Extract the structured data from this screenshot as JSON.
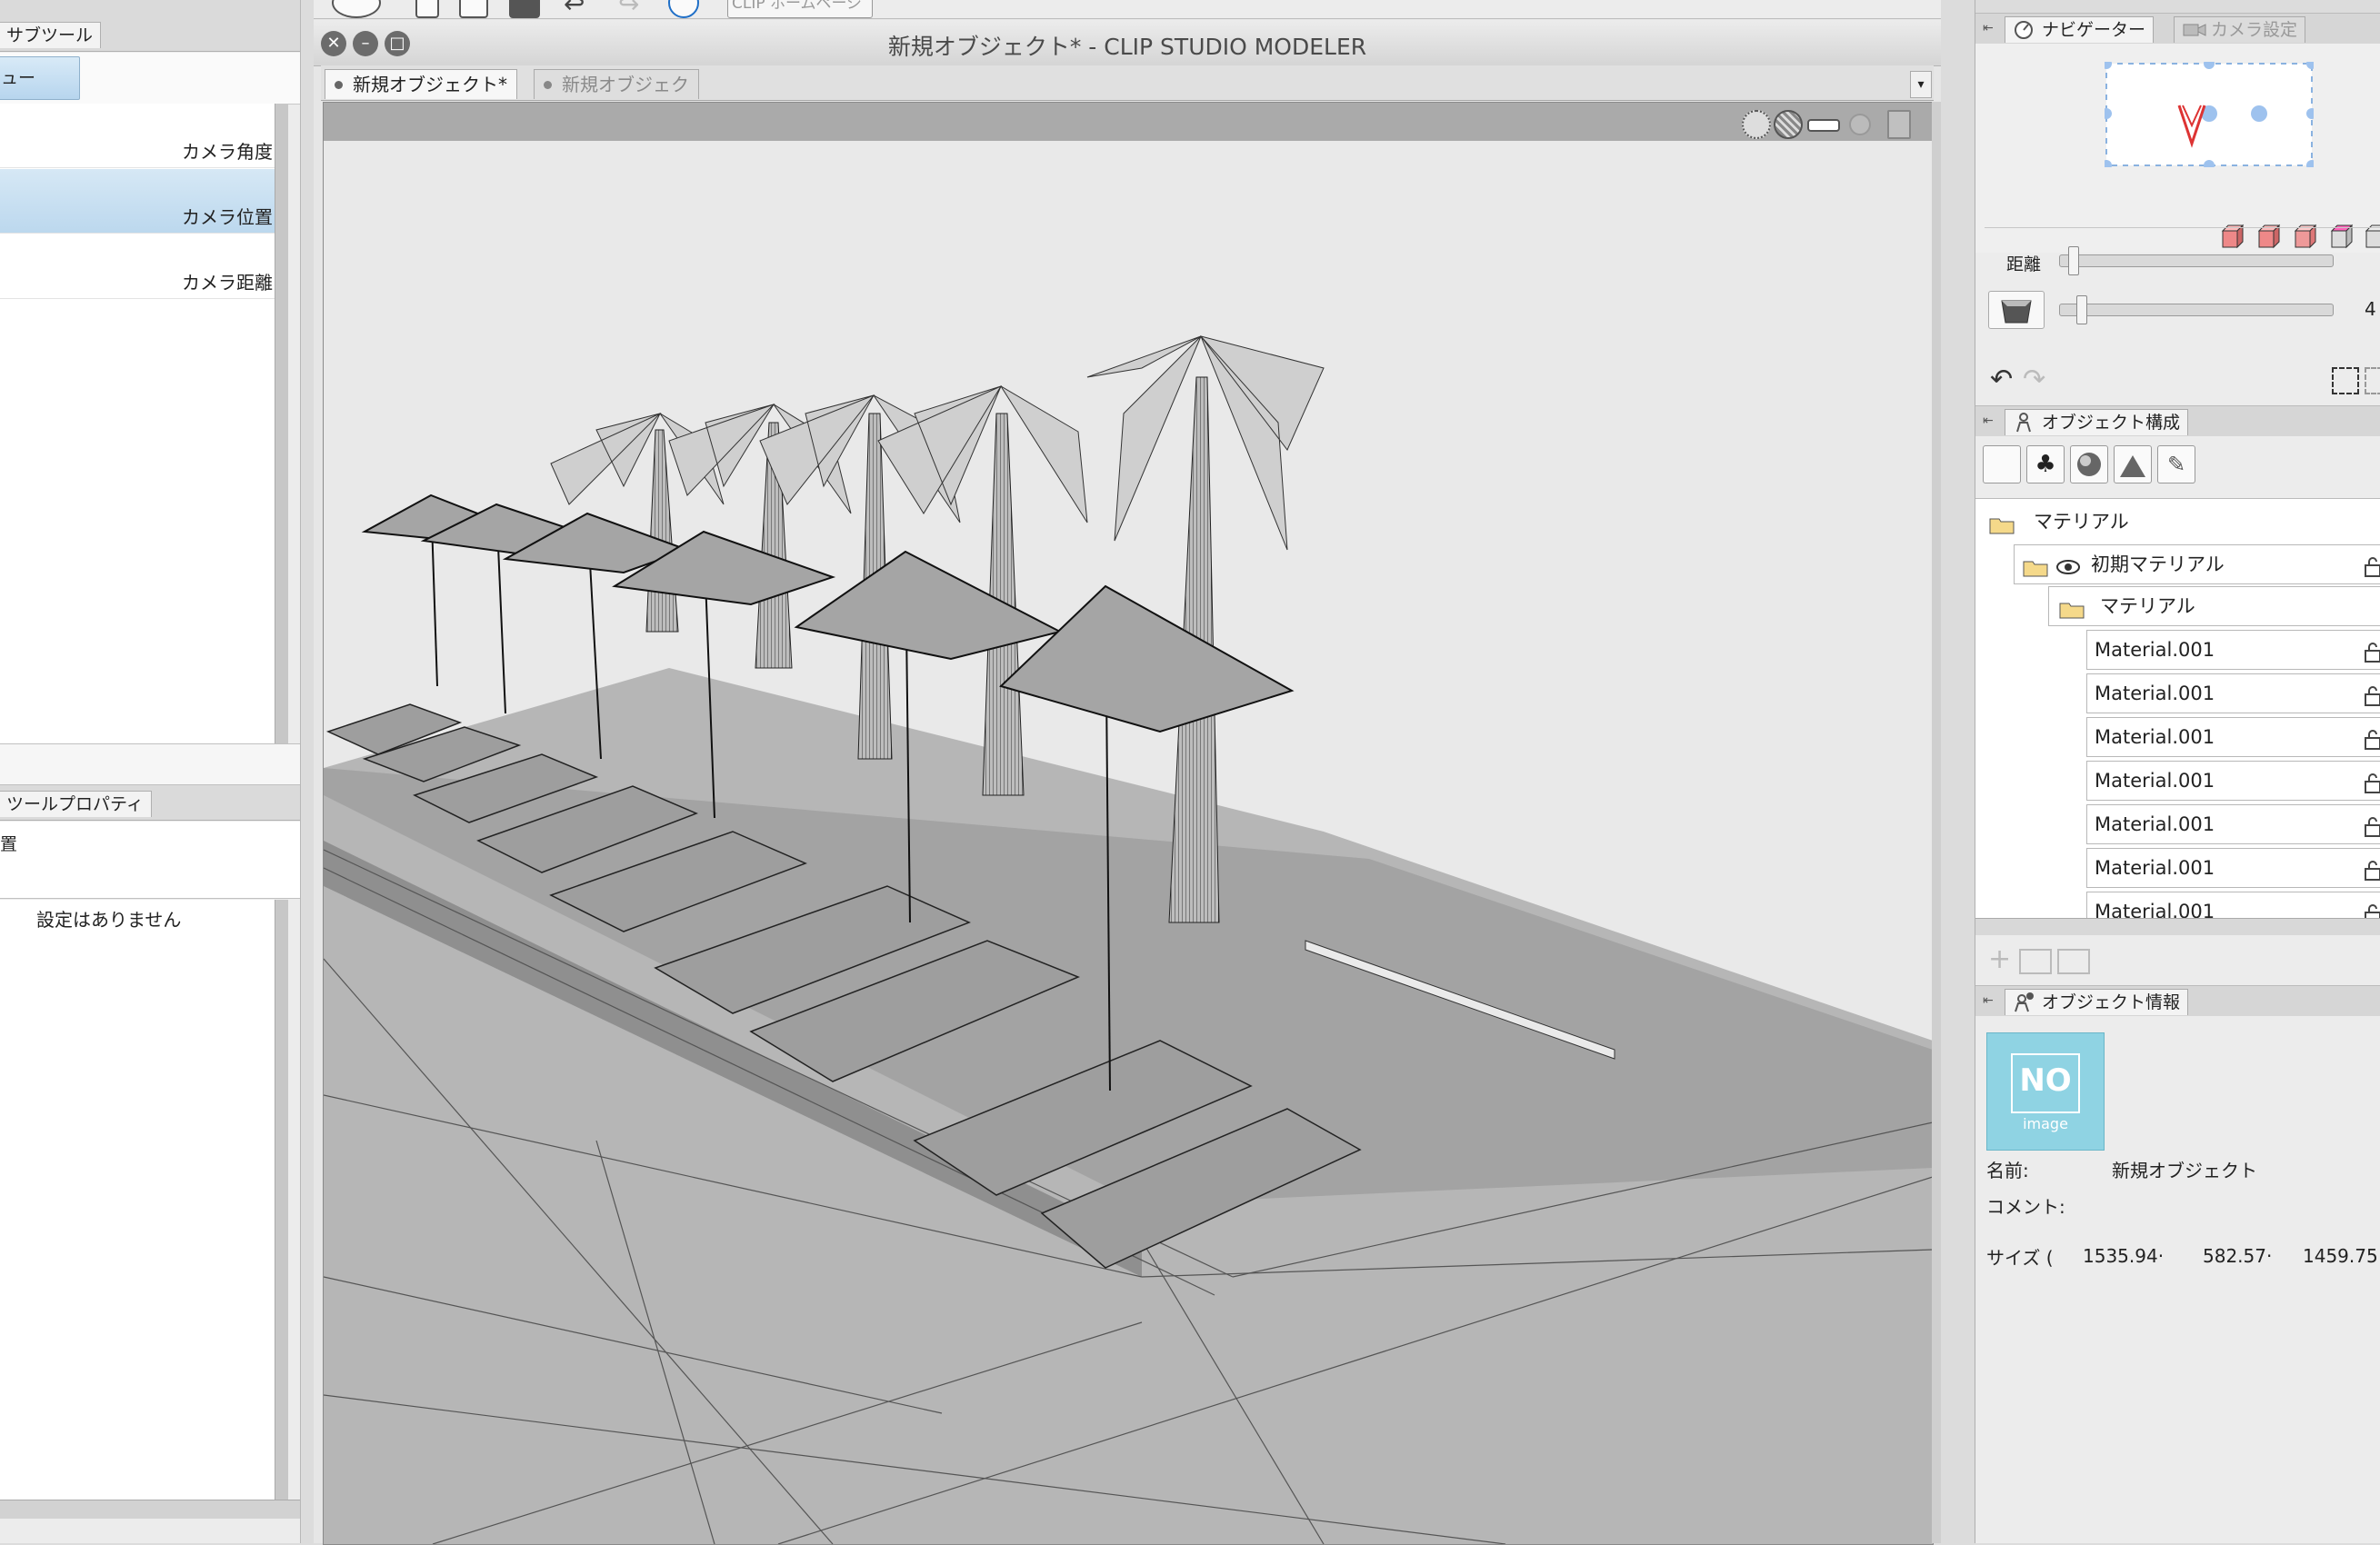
{
  "left_panel": {
    "subtool_tab": "サブツール",
    "subtool_group_label": "ュー",
    "camera_items": [
      {
        "label": "カメラ角度",
        "selected": false
      },
      {
        "label": "カメラ位置",
        "selected": true
      },
      {
        "label": "カメラ距離",
        "selected": false
      }
    ],
    "tool_property_tab": "ツールプロパティ",
    "tool_property_title": "置",
    "tool_property_empty": "設定はありません"
  },
  "center": {
    "toolbar_partial_label": "CLIP ホームページ",
    "window_title": "新規オブジェクト* - CLIP STUDIO MODELER",
    "doc_tabs": [
      {
        "label": "新規オブジェクト*",
        "active": true
      },
      {
        "label": "新規オブジェク",
        "active": false
      }
    ],
    "tabs_dropdown": "▾"
  },
  "right_panel": {
    "navigator": {
      "tab_label": "ナビゲーター",
      "camera_tab_label": "カメラ設定",
      "distance_label": "距離",
      "distance_value": 0.03,
      "zoom_value": 0.06,
      "zoom_partial_number": "4"
    },
    "object_structure": {
      "tab_label": "オブジェクト構成",
      "tree": [
        {
          "label": "マテリアル",
          "level": 0,
          "type": "folder"
        },
        {
          "label": "初期マテリアル",
          "level": 1,
          "type": "folder-eye"
        },
        {
          "label": "マテリアル",
          "level": 2,
          "type": "folder"
        },
        {
          "label": "Material.001",
          "level": 3,
          "type": "item"
        },
        {
          "label": "Material.001",
          "level": 3,
          "type": "item"
        },
        {
          "label": "Material.001",
          "level": 3,
          "type": "item"
        },
        {
          "label": "Material.001",
          "level": 3,
          "type": "item"
        },
        {
          "label": "Material.001",
          "level": 3,
          "type": "item"
        },
        {
          "label": "Material.001",
          "level": 3,
          "type": "item"
        },
        {
          "label": "Material.001",
          "level": 3,
          "type": "item"
        }
      ]
    },
    "object_info": {
      "tab_label": "オブジェクト情報",
      "thumb_text": "NO",
      "thumb_subtext": "image",
      "name_label": "名前:",
      "name_value": "新規オブジェクト",
      "comment_label": "コメント:",
      "size_label": "サイズ (",
      "size_values": [
        "1535.94·",
        "582.57·",
        "1459.75"
      ]
    }
  },
  "colors": {
    "selection_blue": "#c6dff2",
    "thumb_cyan": "#8fd3e3",
    "scene_gray": "#9a9a9a"
  }
}
